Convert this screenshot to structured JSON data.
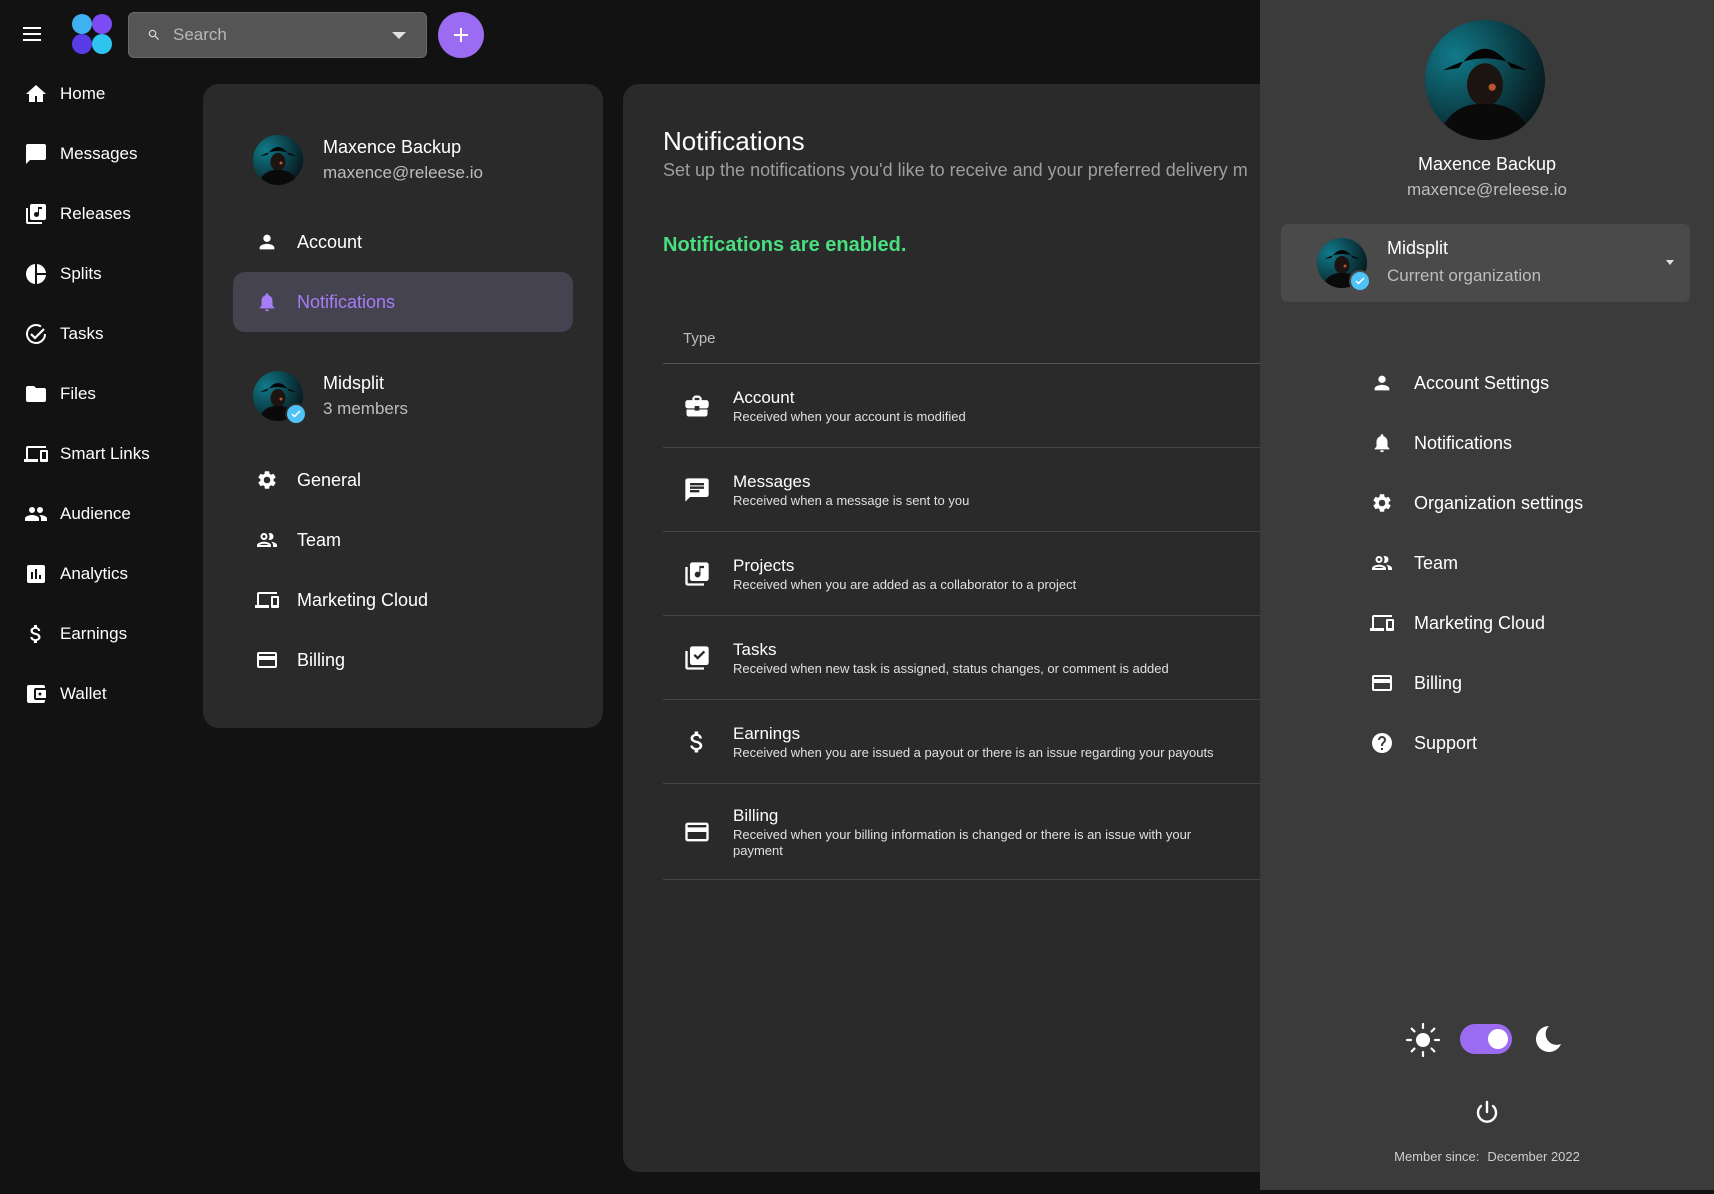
{
  "topbar": {
    "search_placeholder": "Search"
  },
  "left_nav": {
    "items": [
      {
        "label": "Home",
        "icon": "home-icon"
      },
      {
        "label": "Messages",
        "icon": "chat-icon"
      },
      {
        "label": "Releases",
        "icon": "music-library-icon"
      },
      {
        "label": "Splits",
        "icon": "pie-chart-icon"
      },
      {
        "label": "Tasks",
        "icon": "check-circle-icon"
      },
      {
        "label": "Files",
        "icon": "folder-icon"
      },
      {
        "label": "Smart Links",
        "icon": "devices-icon"
      },
      {
        "label": "Audience",
        "icon": "people-icon"
      },
      {
        "label": "Analytics",
        "icon": "bar-chart-icon"
      },
      {
        "label": "Earnings",
        "icon": "dollar-icon"
      },
      {
        "label": "Wallet",
        "icon": "wallet-icon"
      }
    ]
  },
  "settings": {
    "user": {
      "name": "Maxence Backup",
      "email": "maxence@releese.io"
    },
    "user_items": [
      {
        "label": "Account",
        "icon": "person-icon"
      },
      {
        "label": "Notifications",
        "icon": "bell-icon",
        "active": true
      }
    ],
    "org": {
      "name": "Midsplit",
      "members": "3 members"
    },
    "org_items": [
      {
        "label": "General",
        "icon": "gear-icon"
      },
      {
        "label": "Team",
        "icon": "people-icon"
      },
      {
        "label": "Marketing Cloud",
        "icon": "devices-icon"
      },
      {
        "label": "Billing",
        "icon": "credit-card-icon"
      }
    ]
  },
  "notifications": {
    "title": "Notifications",
    "subtitle": "Set up the notifications you'd like to receive and your preferred delivery m",
    "status": "Notifications are enabled.",
    "table_header": "Type",
    "rows": [
      {
        "title": "Account",
        "desc": "Received when your account is modified",
        "icon": "briefcase-icon"
      },
      {
        "title": "Messages",
        "desc": "Received when a message is sent to you",
        "icon": "chat-icon"
      },
      {
        "title": "Projects",
        "desc": "Received when you are added as a collaborator to a project",
        "icon": "music-library-icon"
      },
      {
        "title": "Tasks",
        "desc": "Received when new task is assigned, status changes, or comment is added",
        "icon": "checklist-icon"
      },
      {
        "title": "Earnings",
        "desc": "Received when you are issued a payout or there is an issue regarding your payouts",
        "icon": "dollar-icon"
      },
      {
        "title": "Billing",
        "desc": "Received when your billing information is changed or there is an issue with your payment",
        "icon": "credit-card-icon"
      }
    ]
  },
  "drawer": {
    "name": "Maxence Backup",
    "email": "maxence@releese.io",
    "org_name": "Midsplit",
    "org_sub": "Current organization",
    "items": [
      {
        "label": "Account Settings",
        "icon": "person-icon"
      },
      {
        "label": "Notifications",
        "icon": "bell-icon"
      },
      {
        "label": "Organization settings",
        "icon": "gear-icon"
      },
      {
        "label": "Team",
        "icon": "people-icon"
      },
      {
        "label": "Marketing Cloud",
        "icon": "devices-icon"
      },
      {
        "label": "Billing",
        "icon": "credit-card-icon"
      },
      {
        "label": "Support",
        "icon": "help-icon"
      }
    ],
    "theme_dark": true,
    "member_since_label": "Member since:",
    "member_since_value": "December 2022"
  },
  "colors": {
    "accent": "#9b6cf2",
    "success": "#4ade80",
    "badge": "#4fc3f7"
  }
}
